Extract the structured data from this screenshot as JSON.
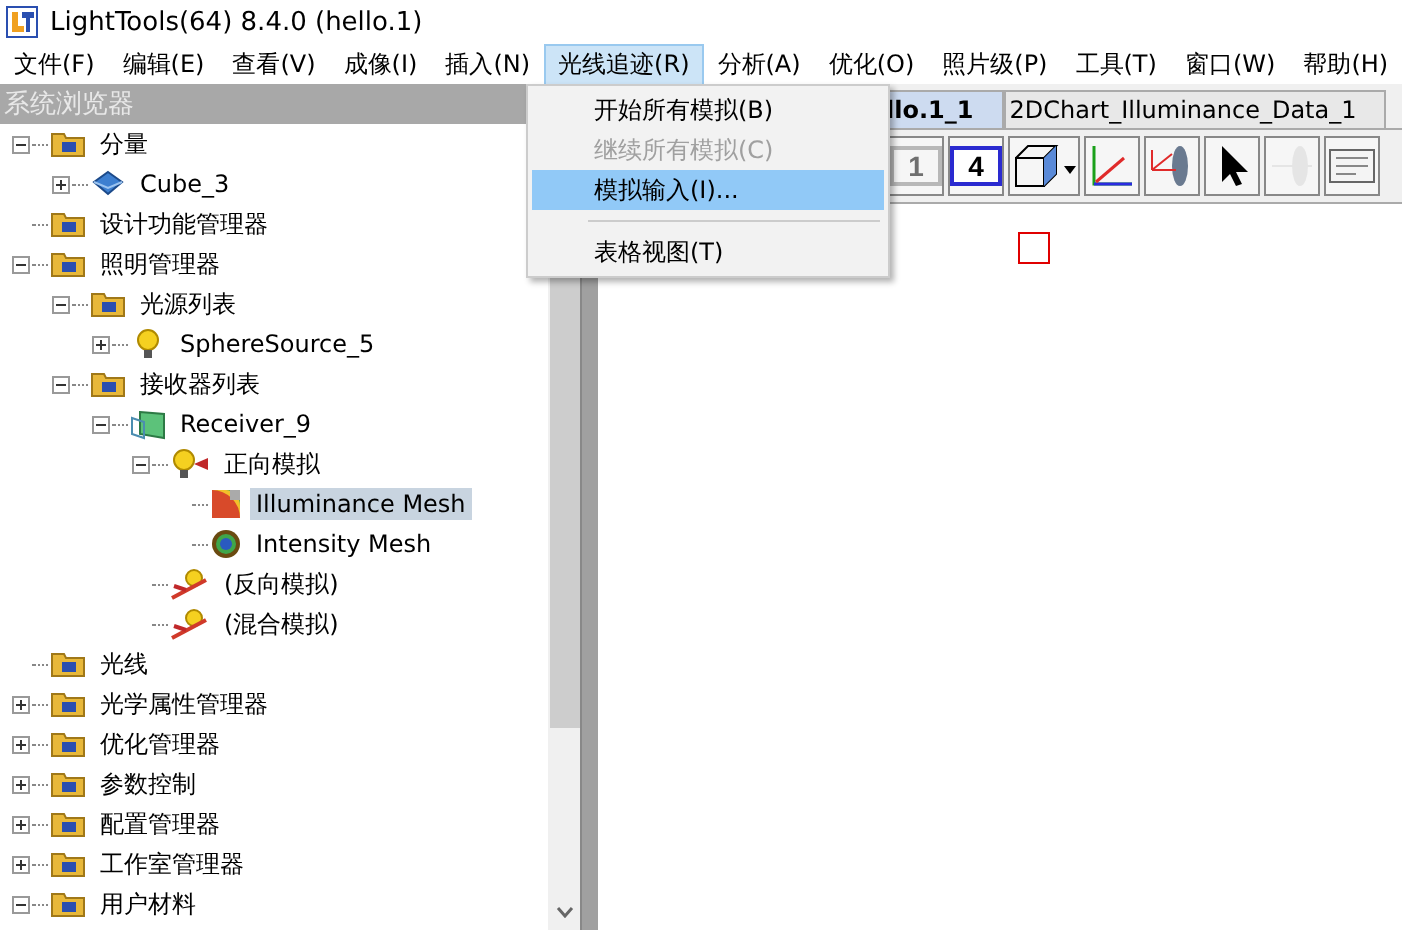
{
  "window": {
    "title": "LightTools(64) 8.4.0  (hello.1)"
  },
  "menu_bar": [
    {
      "label": "文件(F)",
      "selected": false
    },
    {
      "label": "编辑(E)",
      "selected": false
    },
    {
      "label": "查看(V)",
      "selected": false
    },
    {
      "label": "成像(I)",
      "selected": false
    },
    {
      "label": "插入(N)",
      "selected": false
    },
    {
      "label": "光线追迹(R)",
      "selected": true
    },
    {
      "label": "分析(A)",
      "selected": false
    },
    {
      "label": "优化(O)",
      "selected": false
    },
    {
      "label": "照片级(P)",
      "selected": false
    },
    {
      "label": "工具(T)",
      "selected": false
    },
    {
      "label": "窗口(W)",
      "selected": false
    },
    {
      "label": "帮助(H)",
      "selected": false
    }
  ],
  "dropdown_menu": [
    {
      "kind": "item",
      "label": "开始所有模拟(B)",
      "disabled": false,
      "selected": false
    },
    {
      "kind": "item",
      "label": "继续所有模拟(C)",
      "disabled": true,
      "selected": false
    },
    {
      "kind": "item",
      "label": "模拟输入(I)...",
      "disabled": false,
      "selected": true
    },
    {
      "kind": "separator"
    },
    {
      "kind": "item",
      "label": "表格视图(T)",
      "disabled": false,
      "selected": false
    }
  ],
  "sidebar": {
    "title": "系统浏览器",
    "tree": [
      {
        "label": "分量",
        "kind": "folder",
        "expanded": true,
        "selected": false,
        "children": [
          {
            "label": "Cube_3",
            "kind": "cube",
            "expanded": false,
            "selected": false
          }
        ]
      },
      {
        "label": "设计功能管理器",
        "kind": "folder",
        "selected": false
      },
      {
        "label": "照明管理器",
        "kind": "folder",
        "expanded": true,
        "selected": false,
        "children": [
          {
            "label": "光源列表",
            "kind": "folder",
            "expanded": true,
            "selected": false,
            "children": [
              {
                "label": "SphereSource_5",
                "kind": "bulb",
                "expanded": false,
                "selected": false
              }
            ]
          },
          {
            "label": "接收器列表",
            "kind": "folder",
            "expanded": true,
            "selected": false,
            "children": [
              {
                "label": "Receiver_9",
                "kind": "receiver",
                "expanded": true,
                "selected": false,
                "children": [
                  {
                    "label": "正向模拟",
                    "kind": "forward",
                    "expanded": true,
                    "selected": false,
                    "children": [
                      {
                        "label": "Illuminance Mesh",
                        "kind": "mesh",
                        "selected": true
                      },
                      {
                        "label": "Intensity Mesh",
                        "kind": "intensity",
                        "selected": false
                      }
                    ]
                  },
                  {
                    "label": "(反向模拟)",
                    "kind": "reverse",
                    "selected": false
                  },
                  {
                    "label": "(混合模拟)",
                    "kind": "reverse",
                    "selected": false
                  }
                ]
              }
            ]
          }
        ]
      },
      {
        "label": "光线",
        "kind": "folder",
        "selected": false
      },
      {
        "label": "光学属性管理器",
        "kind": "folder",
        "expanded": false,
        "selected": false
      },
      {
        "label": "优化管理器",
        "kind": "folder",
        "expanded": false,
        "selected": false
      },
      {
        "label": "参数控制",
        "kind": "folder",
        "expanded": false,
        "selected": false
      },
      {
        "label": "配置管理器",
        "kind": "folder",
        "expanded": false,
        "selected": false
      },
      {
        "label": "工作室管理器",
        "kind": "folder",
        "expanded": false,
        "selected": false
      },
      {
        "label": "用户材料",
        "kind": "folder",
        "expanded": true,
        "selected": false
      }
    ]
  },
  "tabs": [
    {
      "label": "llo.1_1",
      "selected": true
    },
    {
      "label": "2DChart_Illuminance_Data_1",
      "selected": false
    }
  ],
  "toolbar": [
    {
      "kind": "view",
      "label": "1",
      "disabled": true
    },
    {
      "kind": "view",
      "label": "4",
      "disabled": false
    },
    {
      "kind": "cube",
      "disabled": false
    },
    {
      "kind": "axes",
      "disabled": false
    },
    {
      "kind": "lens",
      "disabled": false
    },
    {
      "kind": "pointer",
      "disabled": false
    },
    {
      "kind": "lens",
      "disabled": true
    },
    {
      "kind": "panel",
      "disabled": false
    }
  ]
}
